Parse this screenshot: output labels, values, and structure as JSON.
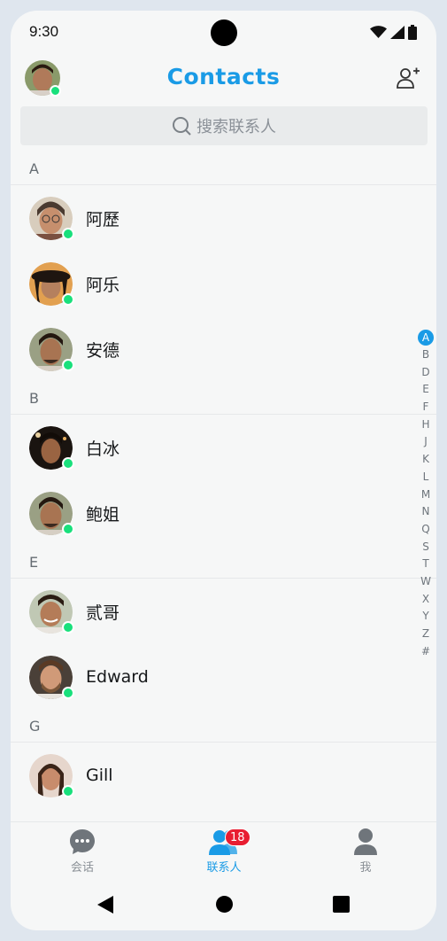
{
  "status_bar": {
    "time": "9:30"
  },
  "header": {
    "title": "Contacts"
  },
  "search": {
    "placeholder": "搜索联系人"
  },
  "sections": [
    {
      "letter": "A",
      "contacts": [
        {
          "name": "阿歷",
          "online": true,
          "avatar_color": "#b58a6e"
        },
        {
          "name": "阿乐",
          "online": true,
          "avatar_color": "#6b4a3a"
        },
        {
          "name": "安德",
          "online": true,
          "avatar_color": "#8a6a52"
        }
      ]
    },
    {
      "letter": "B",
      "contacts": [
        {
          "name": "白冰",
          "online": true,
          "avatar_color": "#3a2a20"
        },
        {
          "name": "鲍姐",
          "online": true,
          "avatar_color": "#8a6a52"
        }
      ]
    },
    {
      "letter": "E",
      "contacts": [
        {
          "name": "贰哥",
          "online": true,
          "avatar_color": "#9a7058"
        },
        {
          "name": "Edward",
          "online": true,
          "avatar_color": "#8f7a66"
        }
      ]
    },
    {
      "letter": "G",
      "contacts": [
        {
          "name": "Gill",
          "online": true,
          "avatar_color": "#7a5a4a"
        }
      ]
    }
  ],
  "alpha_index": [
    "A",
    "B",
    "D",
    "E",
    "F",
    "H",
    "J",
    "K",
    "L",
    "M",
    "N",
    "Q",
    "S",
    "T",
    "W",
    "X",
    "Y",
    "Z",
    "#"
  ],
  "alpha_active": "A",
  "bottom_nav": [
    {
      "label": "会话",
      "icon": "chat-bubble-icon",
      "active": false
    },
    {
      "label": "联系人",
      "icon": "contacts-icon",
      "active": true,
      "badge": "18"
    },
    {
      "label": "我",
      "icon": "person-icon",
      "active": false
    }
  ],
  "colors": {
    "accent": "#1a9be6",
    "online": "#19e07c",
    "badge": "#e81d31"
  }
}
